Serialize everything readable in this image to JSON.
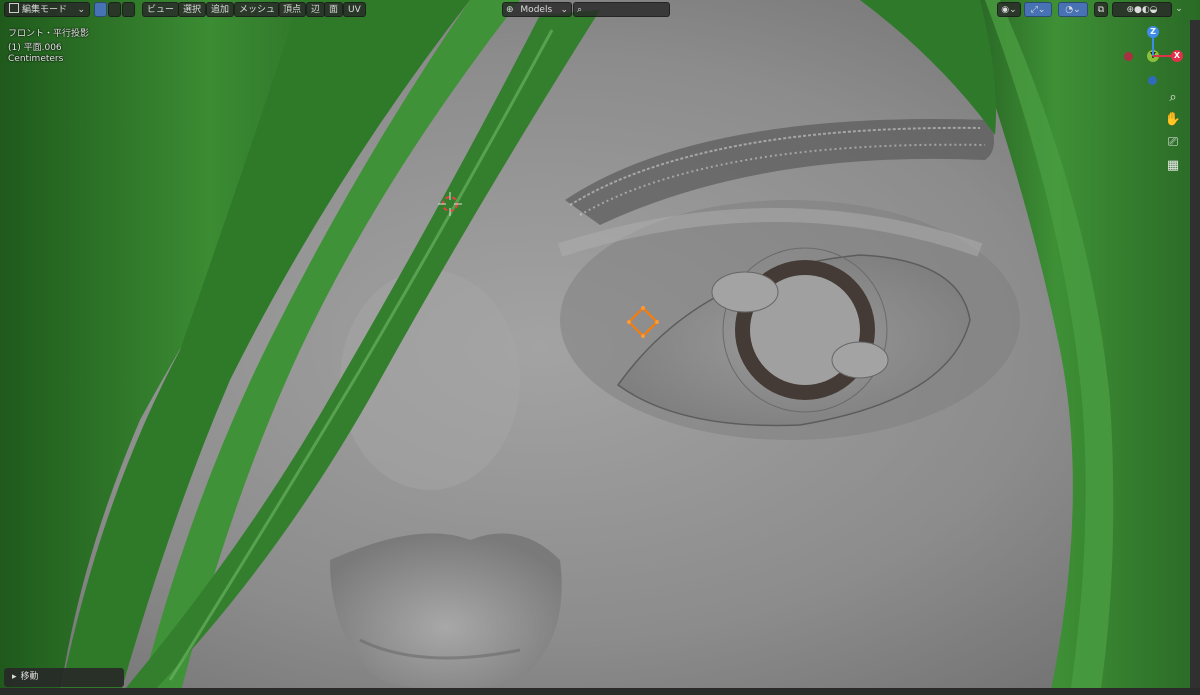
{
  "header": {
    "mode_label": "編集モード",
    "menus": [
      "ビュー",
      "選択",
      "追加",
      "メッシュ",
      "頂点",
      "辺",
      "面",
      "UV"
    ],
    "orientation_label": "Models",
    "search_placeholder": ""
  },
  "overlay": {
    "view_name": "フロント・平行投影",
    "object_name": "(1) 平面.006",
    "units": "Centimeters"
  },
  "gizmo": {
    "z_label": "Z",
    "y_label": "Y",
    "x_label": "X"
  },
  "operator_panel": {
    "label": "移動"
  },
  "colors": {
    "hair": "#2f7a2a",
    "skin": "#8f8f8f",
    "accent_orange": "#ff7a00",
    "axis_x": "#e0304a",
    "axis_y": "#8bc23a",
    "axis_z": "#3d8ce8"
  },
  "icons": [
    "editor-type-icon",
    "vertex-select-icon",
    "edge-select-icon",
    "face-select-icon",
    "transform-orientation-icon",
    "search-icon",
    "zoom-icon",
    "hand-icon",
    "camera-icon",
    "grid-icon"
  ]
}
